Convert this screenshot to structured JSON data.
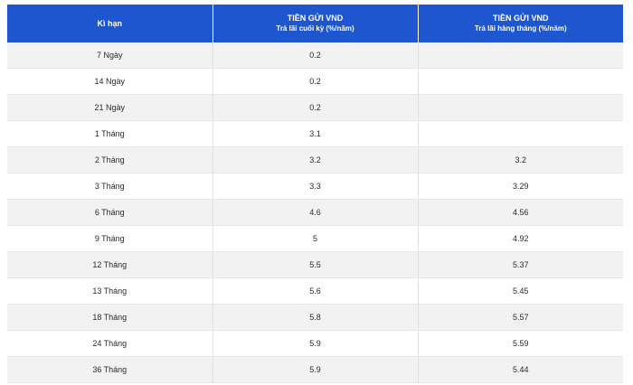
{
  "table": {
    "headers": [
      {
        "title": "Kì hạn",
        "subtitle": ""
      },
      {
        "title": "TIỀN GỬI VND",
        "subtitle": "Trả lãi cuối kỳ (%/năm)"
      },
      {
        "title": "TIỀN GỬI VND",
        "subtitle": "Trả lãi hàng tháng (%/năm)"
      }
    ],
    "rows": [
      [
        "7 Ngày",
        "0.2",
        ""
      ],
      [
        "14 Ngày",
        "0.2",
        ""
      ],
      [
        "21 Ngày",
        "0.2",
        ""
      ],
      [
        "1 Tháng",
        "3.1",
        ""
      ],
      [
        "2 Tháng",
        "3.2",
        "3.2"
      ],
      [
        "3 Tháng",
        "3.3",
        "3.29"
      ],
      [
        "6 Tháng",
        "4.6",
        "4.56"
      ],
      [
        "9 Tháng",
        "5",
        "4.92"
      ],
      [
        "12 Tháng",
        "5.5",
        "5.37"
      ],
      [
        "13 Tháng",
        "5.6",
        "5.45"
      ],
      [
        "18 Tháng",
        "5.8",
        "5.57"
      ],
      [
        "24 Tháng",
        "5.9",
        "5.59"
      ],
      [
        "36 Tháng",
        "5.9",
        "5.44"
      ]
    ]
  },
  "colors": {
    "header_background": "#1d56cf",
    "header_text": "#ffffff",
    "row_stripe": "#f2f2f2"
  }
}
